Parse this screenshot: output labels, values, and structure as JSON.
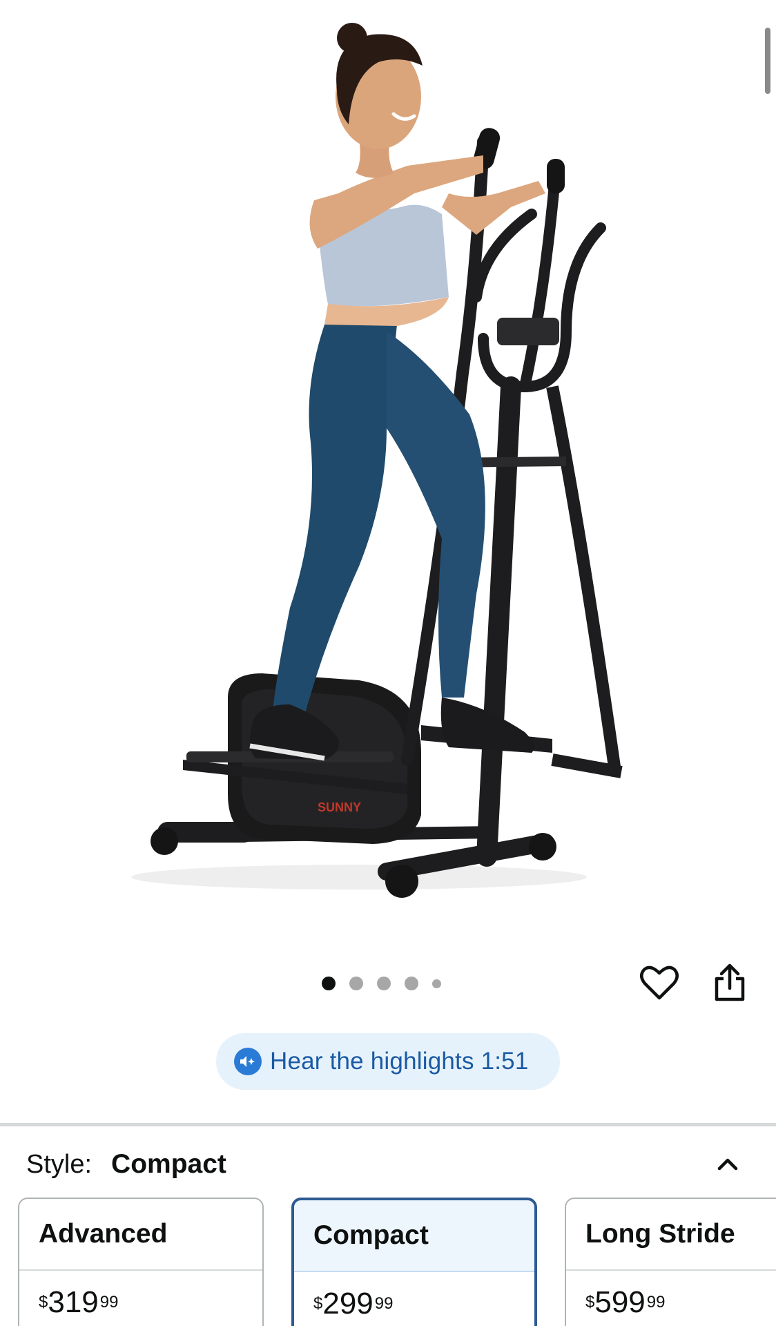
{
  "product": {
    "brand_logo_text": "SUNNY",
    "image_alt": "Woman exercising on an elliptical machine"
  },
  "carousel": {
    "total": 5,
    "active_index": 0
  },
  "actions": {
    "favorite_icon": "heart-icon",
    "share_icon": "share-icon"
  },
  "audio_highlights": {
    "label": "Hear the highlights 1:51",
    "icon": "speaker-sparkle-icon",
    "accent_color": "#2a7bd6"
  },
  "style_selector": {
    "label": "Style:",
    "selected_value": "Compact",
    "collapse_icon": "chevron-up-icon",
    "options": [
      {
        "name": "Advanced",
        "price_symbol": "$",
        "price_whole": "319",
        "price_fraction": "99"
      },
      {
        "name": "Compact",
        "price_symbol": "$",
        "price_whole": "299",
        "price_fraction": "99"
      },
      {
        "name": "Long Stride",
        "price_symbol": "$",
        "price_whole": "599",
        "price_fraction": "99"
      }
    ]
  },
  "colors": {
    "selected_border": "#2d5a91",
    "selected_bg": "#edf6fc",
    "text": "#0f1111"
  }
}
